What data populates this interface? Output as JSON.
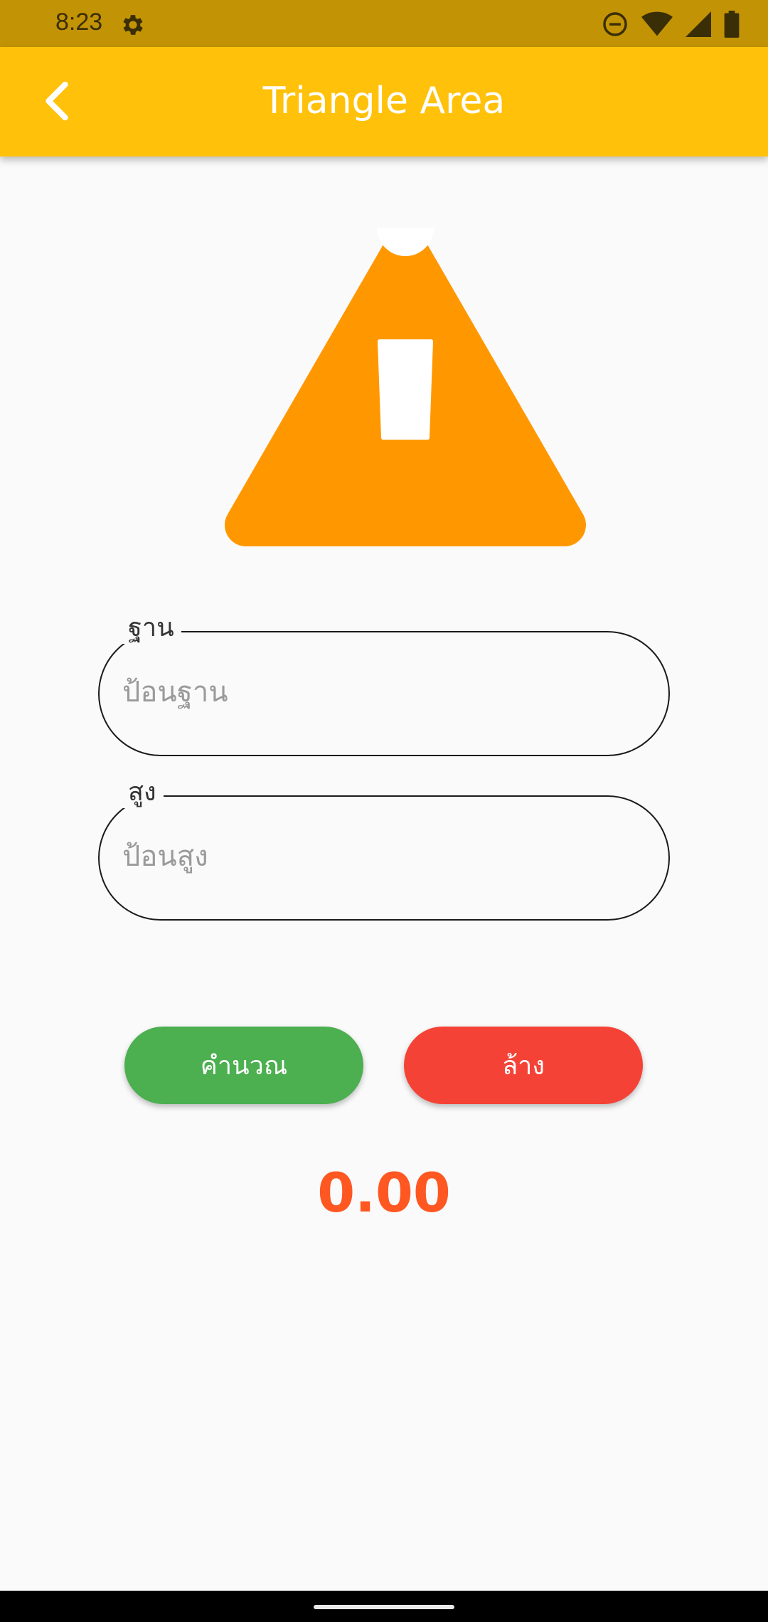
{
  "status_bar": {
    "time": "8:23",
    "icons": [
      "settings-gear-icon",
      "do-not-disturb-icon",
      "wifi-icon",
      "cell-signal-icon",
      "battery-icon"
    ]
  },
  "app_bar": {
    "title": "Triangle Area",
    "back_icon": "chevron-left-icon"
  },
  "graphic": {
    "icon": "warning-triangle-icon",
    "color": "#ff9800"
  },
  "form": {
    "base_label": "ฐาน",
    "base_placeholder": "ป้อนฐาน",
    "height_label": "สูง",
    "height_placeholder": "ป้อนสูง"
  },
  "buttons": {
    "calculate_label": "คำนวณ",
    "clear_label": "ล้าง"
  },
  "result": {
    "value": "0.00"
  },
  "colors": {
    "status_bar": "#c29304",
    "app_bar": "#ffc10a",
    "calculate_button": "#4caf50",
    "clear_button": "#f44336",
    "result_text": "#ff5722"
  }
}
